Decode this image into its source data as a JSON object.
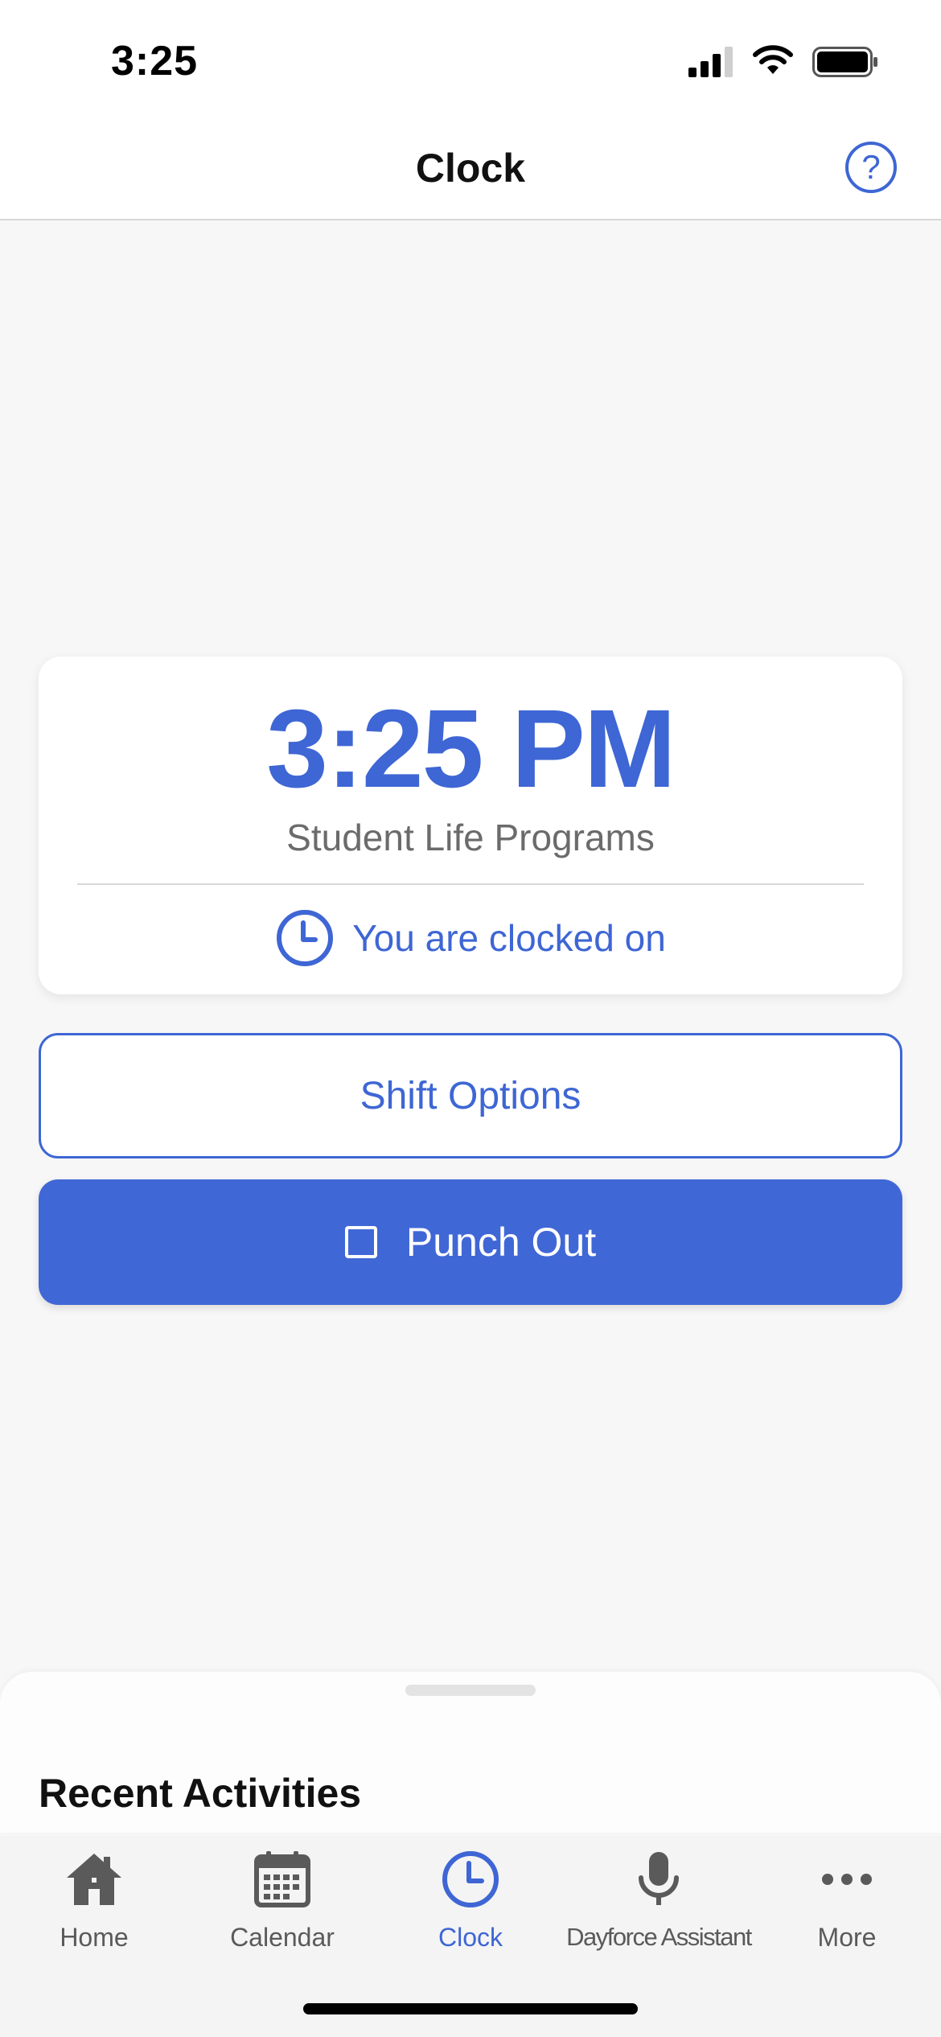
{
  "status_bar": {
    "time": "3:25",
    "icons": [
      "cellular-signal-icon",
      "wifi-icon",
      "battery-icon"
    ]
  },
  "header": {
    "title": "Clock",
    "help_icon": "question-mark-icon",
    "help_label": "?"
  },
  "clock_card": {
    "time": "3:25 PM",
    "org": "Student Life Programs",
    "status": "You are clocked on",
    "status_icon": "clock-icon"
  },
  "actions": {
    "shift_options": "Shift Options",
    "punch_out": "Punch Out",
    "punch_out_icon": "stop-square-icon"
  },
  "recent": {
    "title": "Recent Activities"
  },
  "tabs": [
    {
      "label": "Home",
      "icon": "home-icon",
      "active": false
    },
    {
      "label": "Calendar",
      "icon": "calendar-icon",
      "active": false
    },
    {
      "label": "Clock",
      "icon": "clock-icon",
      "active": true
    },
    {
      "label": "Dayforce Assistant",
      "icon": "microphone-icon",
      "active": false
    },
    {
      "label": "More",
      "icon": "more-dots-icon",
      "active": false
    }
  ],
  "colors": {
    "accent": "#3e66d4",
    "primary_button": "#4067d6",
    "background": "#f7f7f7",
    "inactive_tab": "#5a5a5a"
  }
}
